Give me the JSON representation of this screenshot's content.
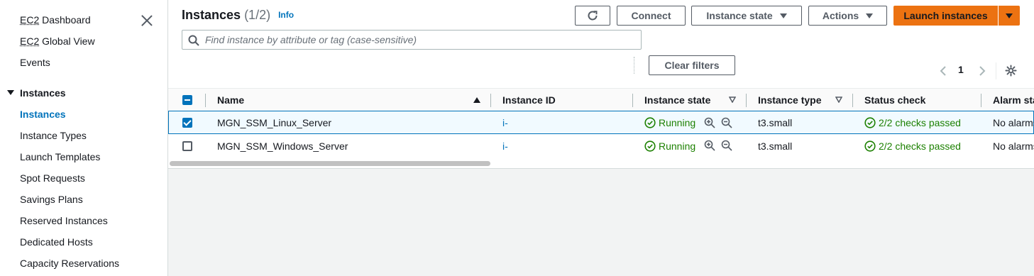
{
  "sidebar": {
    "links_top": [
      {
        "prefix": "EC2",
        "label": " Dashboard"
      },
      {
        "prefix": "EC2",
        "label": " Global View"
      },
      {
        "prefix": "",
        "label": "Events"
      }
    ],
    "section": "Instances",
    "items": [
      "Instances",
      "Instance Types",
      "Launch Templates",
      "Spot Requests",
      "Savings Plans",
      "Reserved Instances",
      "Dedicated Hosts",
      "Capacity Reservations"
    ]
  },
  "header": {
    "title": "Instances",
    "count": "(1/2)",
    "info": "Info",
    "buttons": {
      "connect": "Connect",
      "instance_state": "Instance state",
      "actions": "Actions",
      "launch": "Launch instances"
    }
  },
  "search": {
    "placeholder": "Find instance by attribute or tag (case-sensitive)",
    "value": ""
  },
  "filters": {
    "clear": "Clear filters"
  },
  "pagination": {
    "page": "1"
  },
  "table": {
    "columns": [
      "Name",
      "Instance ID",
      "Instance state",
      "Instance type",
      "Status check",
      "Alarm status"
    ],
    "rows": [
      {
        "selected": true,
        "name": "MGN_SSM_Linux_Server",
        "id": "i-",
        "state": "Running",
        "type": "t3.small",
        "status": "2/2 checks passed",
        "alarm": "No alarms"
      },
      {
        "selected": false,
        "name": "MGN_SSM_Windows_Server",
        "id": "i-",
        "state": "Running",
        "type": "t3.small",
        "status": "2/2 checks passed",
        "alarm": "No alarms"
      }
    ]
  },
  "colors": {
    "accent": "#0073bb",
    "primary_button": "#ec7211",
    "success": "#1d8102"
  }
}
